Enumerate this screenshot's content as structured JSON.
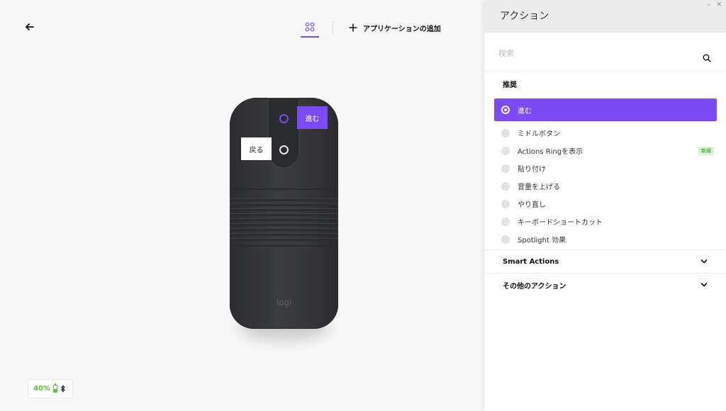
{
  "toolbar": {
    "add_app_label": "アプリケーションの追加"
  },
  "device": {
    "logo_text": "logi",
    "battery_percent_text": "40%",
    "battery_level": 0.4,
    "callouts": {
      "forward": "進む",
      "back": "戻る"
    }
  },
  "panel": {
    "title": "アクション",
    "search_placeholder": "検索",
    "recommended_title": "推奨",
    "selected_action": "進む",
    "actions": [
      {
        "label": "ミドルボタン",
        "badge": ""
      },
      {
        "label": "Actions Ringを表示",
        "badge": "新規"
      },
      {
        "label": "貼り付け",
        "badge": ""
      },
      {
        "label": "音量を上げる",
        "badge": ""
      },
      {
        "label": "やり直し",
        "badge": ""
      },
      {
        "label": "キーボードショートカット",
        "badge": ""
      },
      {
        "label": "Spotlight 効果",
        "badge": ""
      }
    ],
    "sections": {
      "smart_actions": "Smart Actions",
      "other_actions": "その他のアクション"
    }
  },
  "colors": {
    "accent": "#7b4cf5",
    "battery": "#58c23c"
  }
}
